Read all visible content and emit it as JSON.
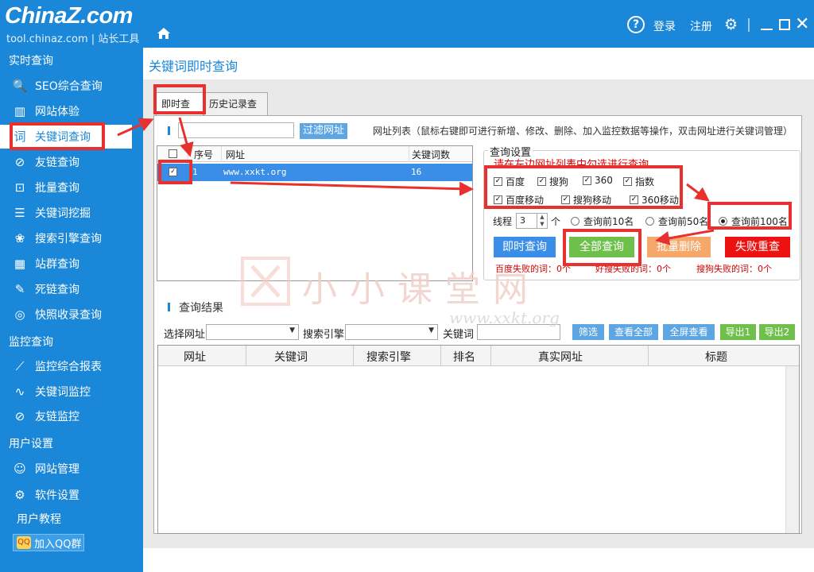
{
  "header": {
    "logo": "ChinaZ.com",
    "logo_sub": "tool.chinaz.com | 站长工具",
    "login": "登录",
    "register": "注册"
  },
  "sidebar": {
    "sections": {
      "realtime": "实时查询",
      "monitor": "监控查询",
      "user": "用户设置"
    },
    "items": [
      {
        "label": "SEO综合查询",
        "icon": "seo-search-icon"
      },
      {
        "label": "网站体验",
        "icon": "bar-chart-icon"
      },
      {
        "label": "关键词查询",
        "icon": "keyword-icon"
      },
      {
        "label": "友链查询",
        "icon": "link-icon"
      },
      {
        "label": "批量查询",
        "icon": "batch-search-icon"
      },
      {
        "label": "关键词挖掘",
        "icon": "list-icon"
      },
      {
        "label": "搜索引擎查询",
        "icon": "paw-icon"
      },
      {
        "label": "站群查询",
        "icon": "grid-chart-icon"
      },
      {
        "label": "死链查询",
        "icon": "broken-link-icon"
      },
      {
        "label": "快照收录查询",
        "icon": "camera-icon"
      },
      {
        "label": "监控综合报表",
        "icon": "line-chart-icon"
      },
      {
        "label": "关键词监控",
        "icon": "wave-chart-icon"
      },
      {
        "label": "友链监控",
        "icon": "link-monitor-icon"
      },
      {
        "label": "网站管理",
        "icon": "user-gear-icon"
      },
      {
        "label": "软件设置",
        "icon": "settings-icon"
      }
    ],
    "tutorial": "用户教程",
    "qq_group": "加入QQ群"
  },
  "page": {
    "title": "关键词即时查询",
    "tabs": [
      "即时查询",
      "历史记录查询"
    ]
  },
  "filter": {
    "button": "过滤网址",
    "hint": "网址列表（鼠标右键即可进行新增、修改、删除、加入监控数据等操作，双击网址进行关键词管理）"
  },
  "site_table": {
    "headers": [
      "序号",
      "网址",
      "关键词数"
    ],
    "rows": [
      {
        "index": "1",
        "url": "www.xxkt.org",
        "count": "16",
        "checked": true
      }
    ]
  },
  "query_settings": {
    "legend": "查询设置",
    "tip": "请在左边网址列表中勾选进行查询",
    "engines": [
      "百度",
      "搜狗",
      "360",
      "指数",
      "百度移动",
      "搜狗移动",
      "360移动"
    ],
    "thread_label": "线程",
    "thread_value": "3",
    "thread_unit": "个",
    "ranges": [
      "查询前10名",
      "查询前50名",
      "查询前100名"
    ],
    "selected_range": "查询前100名",
    "buttons": {
      "instant": "即时查询",
      "all": "全部查询",
      "batch_delete": "批量删除",
      "fail_retry": "失败重查"
    },
    "fail": {
      "baidu": "百度失败的词：0个",
      "sogou": "好搜失败的词：0个",
      "sogou2": "搜狗失败的词：0个"
    }
  },
  "results": {
    "title": "查询结果",
    "select_site": "选择网址",
    "search_engine": "搜索引擎",
    "keyword": "关键词",
    "buttons": [
      "筛选",
      "查看全部",
      "全屏查看",
      "导出1",
      "导出2"
    ],
    "headers": [
      "网址",
      "关键词",
      "搜索引擎",
      "排名",
      "真实网址",
      "标题"
    ]
  },
  "watermark": {
    "text": "小小课堂网",
    "url": "www.xxkt.org"
  },
  "colors": {
    "brand": "#1a87d9",
    "highlight": "#e8312e",
    "green_button": "#6ec04a",
    "orange_button": "#f6a86a",
    "red_button": "#ee1111"
  }
}
